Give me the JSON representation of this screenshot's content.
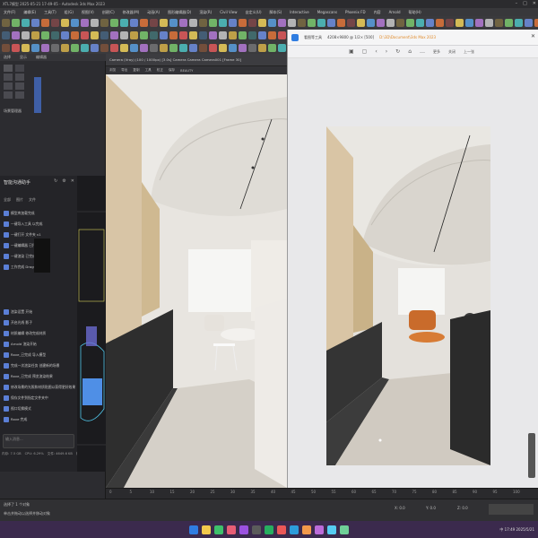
{
  "title_bar": {
    "title": "XTL7模型 2025-05-21 17-49-05 - Autodesk 3ds Max 2023",
    "controls": [
      "–",
      "□",
      "✕"
    ]
  },
  "menu": [
    "文件(F)",
    "编辑(E)",
    "工具(T)",
    "组(G)",
    "视图(V)",
    "创建(C)",
    "修改器(M)",
    "动画(A)",
    "图形编辑器(D)",
    "渲染(R)",
    "Civil View",
    "自定义(U)",
    "脚本(S)",
    "Interactive",
    "Megascans",
    "Phoenix FD",
    "内容",
    "Arnold",
    "帮助(H)"
  ],
  "left_panel": {
    "tabs": [
      "选择",
      "显示",
      "编辑器"
    ],
    "section_label": "场景管理器"
  },
  "chat": {
    "title": "智能沟通助手",
    "filters": [
      "全部",
      "图片",
      "文件"
    ],
    "messages": [
      "模型库加载完成",
      "一键导入工具 以完成",
      "一键打开 文件夹 v1",
      "一键编辑器 已打开 v1",
      "一键渲染 已完成 v1",
      "工作完成 DragOn v1",
      "渲染设置 开始",
      "开启光线 影子",
      "材质编辑 修改完成材质",
      "Arnold 渲染开始",
      "Rave_已完成 导入模型",
      "完成一次渲染任务 创建新的场景",
      "Rave_已完成 预览渲染结果",
      "修改场景的光照和材质贴图以获得更好效果",
      "保存文件到指定文件夹中",
      "视口切换模式",
      "Rave 完成"
    ],
    "input_placeholder": "输入消息...",
    "status": [
      "内存: 7.5 GB",
      "CPU: 6.29%",
      "文件: 4649.6 KB",
      "帧率: 30 fps"
    ]
  },
  "render_window": {
    "title": "Camera (Vray) (100 / 1000px) [3.0s] Camera Camera Camera001 [Frame 30]",
    "tabs": [
      "浏览",
      "导出",
      "复制",
      "工具",
      "校正",
      "保存",
      "BEAUTY"
    ]
  },
  "image_viewer": {
    "title": "看图等工具",
    "file": "4208×9800 @ 1/2× [500]",
    "extra_file": "D:\\3D\\Document\\3ds Max 2023",
    "tools": [
      "▣",
      "▢",
      "‹",
      "›",
      "↻",
      "⌂",
      "…"
    ],
    "tool_right": [
      "更多",
      "关闭",
      "上一张"
    ]
  },
  "timeline": {
    "ticks": [
      "0",
      "5",
      "10",
      "15",
      "20",
      "25",
      "30",
      "35",
      "40",
      "45",
      "50",
      "55",
      "60",
      "65",
      "70",
      "75",
      "80",
      "85",
      "90",
      "95",
      "100"
    ]
  },
  "status_bar": {
    "left": "选择了 1 个对象",
    "hint": "单击并拖动以选择并移动对象",
    "coord_x": "X: 0.0",
    "coord_y": "Y: 0.0",
    "coord_z": "Z: 0.0"
  },
  "taskbar": {
    "tray": "中 17:49 2025/5/21"
  },
  "colors": {
    "accent": "#2f7de1",
    "taskbar": "#3b2a4d"
  }
}
